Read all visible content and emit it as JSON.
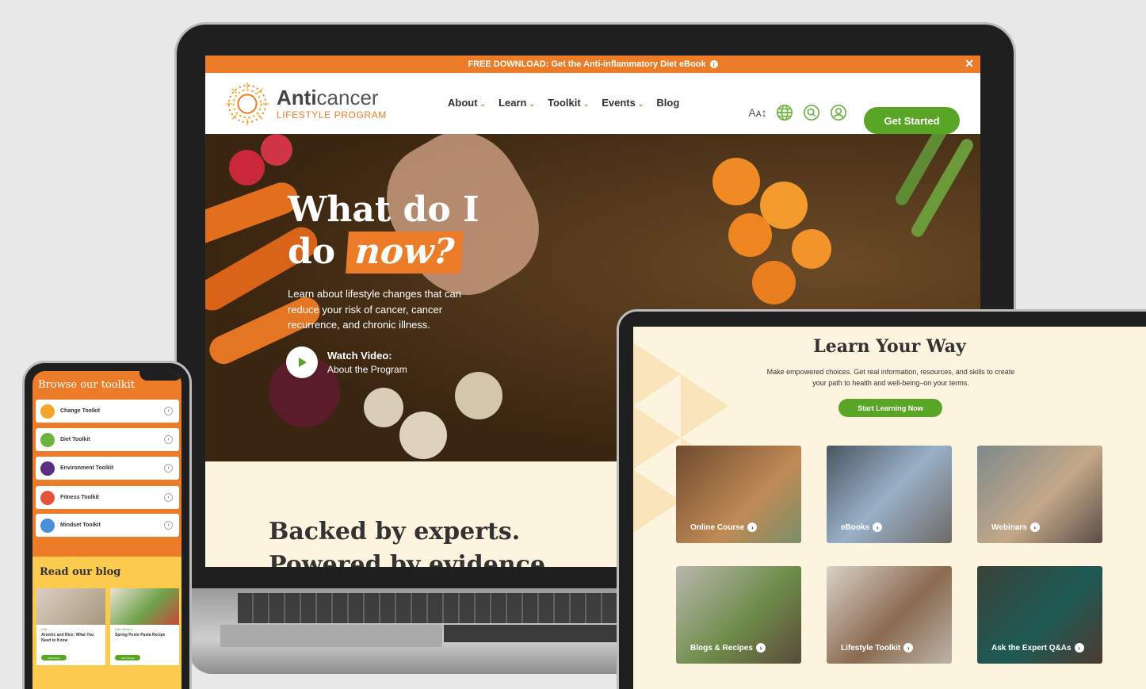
{
  "laptop": {
    "promo": {
      "text": "FREE DOWNLOAD: Get the Anti-inflammatory Diet eBook",
      "close": "✕"
    },
    "logo": {
      "main_bold": "Anti",
      "main_rest": "cancer",
      "sub": "LIFESTYLE PROGRAM"
    },
    "nav": [
      {
        "label": "About",
        "has_dropdown": true
      },
      {
        "label": "Learn",
        "has_dropdown": true
      },
      {
        "label": "Toolkit",
        "has_dropdown": true
      },
      {
        "label": "Events",
        "has_dropdown": true
      },
      {
        "label": "Blog",
        "has_dropdown": false
      }
    ],
    "header_icons": [
      "text-size-icon",
      "globe-icon",
      "search-icon",
      "user-icon"
    ],
    "cta": "Get Started",
    "hero": {
      "title_line1": "What do I",
      "title_line2_pre": "do ",
      "title_line2_highlight": "now?",
      "subtitle": "Learn about lifestyle changes that can reduce your risk of cancer, cancer recurrence, and chronic illness.",
      "watch_title": "Watch Video:",
      "watch_sub": "About the Program"
    },
    "experts": {
      "line1": "Backed by experts.",
      "line2": "Powered by evidence."
    }
  },
  "tablet": {
    "title": "Learn Your Way",
    "subtitle": "Make empowered choices. Get real information, resources, and skills to create your path to health and well-being–on your terms.",
    "cta": "Start Learning Now",
    "cards": [
      {
        "label": "Online Course"
      },
      {
        "label": "eBooks"
      },
      {
        "label": "Webinars"
      },
      {
        "label": "Blogs & Recipes"
      },
      {
        "label": "Lifestyle Toolkit"
      },
      {
        "label": "Ask the Expert Q&As"
      }
    ]
  },
  "phone": {
    "title": "Browse our toolkit",
    "toolkits": [
      {
        "label": "Change Toolkit",
        "color": "#f4a52a"
      },
      {
        "label": "Diet Toolkit",
        "color": "#6db33f"
      },
      {
        "label": "Environment Toolkit",
        "color": "#5b2d83"
      },
      {
        "label": "Fitness Toolkit",
        "color": "#e5523a"
      },
      {
        "label": "Mindset Toolkit",
        "color": "#4a90d9"
      }
    ],
    "blog_title": "Read our blog",
    "blogs": [
      {
        "category": "Diet",
        "name": "Arsenic and Rice: What You Need to Know",
        "button": "Read More"
      },
      {
        "category": "Diet, Recipe",
        "name": "Spring Pesto Pasta Recipe",
        "button": "View Recipe"
      }
    ]
  },
  "colors": {
    "orange": "#ec7c27",
    "green": "#59a526",
    "cream": "#fdf4e0"
  }
}
